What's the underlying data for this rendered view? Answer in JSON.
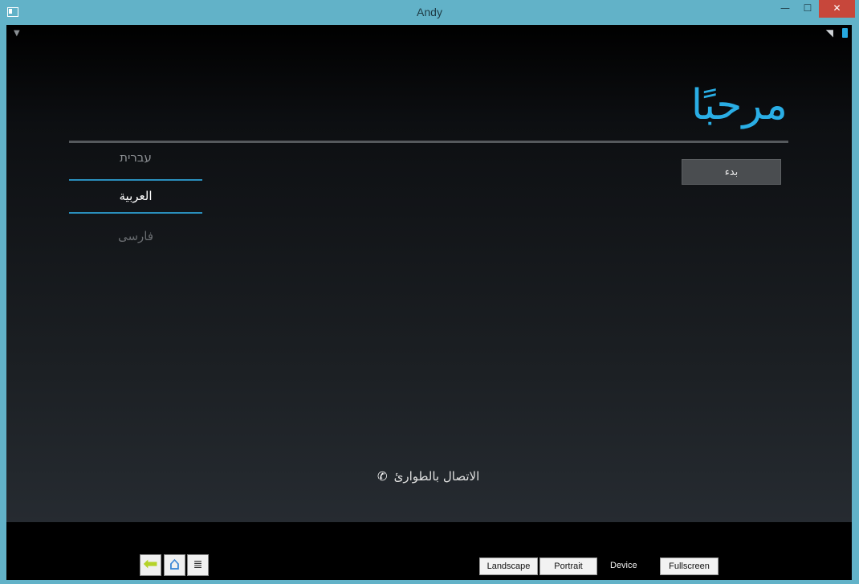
{
  "window": {
    "title": "Andy",
    "minimize_label": "—",
    "maximize_label": "☐",
    "close_label": "✕"
  },
  "status_bar": {
    "signal_left_icon": "signal-icon",
    "wifi_icon": "wifi-icon",
    "battery_icon": "battery-icon"
  },
  "welcome": {
    "title": "مرحبًا"
  },
  "languages": [
    {
      "label": "עברית"
    },
    {
      "label": "العربية"
    },
    {
      "label": "فارسی"
    }
  ],
  "start_button": {
    "label": "بدء"
  },
  "emergency": {
    "label": "الاتصال بالطوارئ",
    "icon": "phone-icon"
  },
  "bottom_bar": {
    "back_icon": "back-arrow-icon",
    "home_icon": "home-icon",
    "menu_icon": "menu-icon",
    "landscape_label": "Landscape",
    "portrait_label": "Portrait",
    "device_label": "Device",
    "fullscreen_label": "Fullscreen"
  },
  "colors": {
    "accent": "#2aaee5",
    "window_frame": "#62b2c8",
    "close": "#c7473b"
  }
}
